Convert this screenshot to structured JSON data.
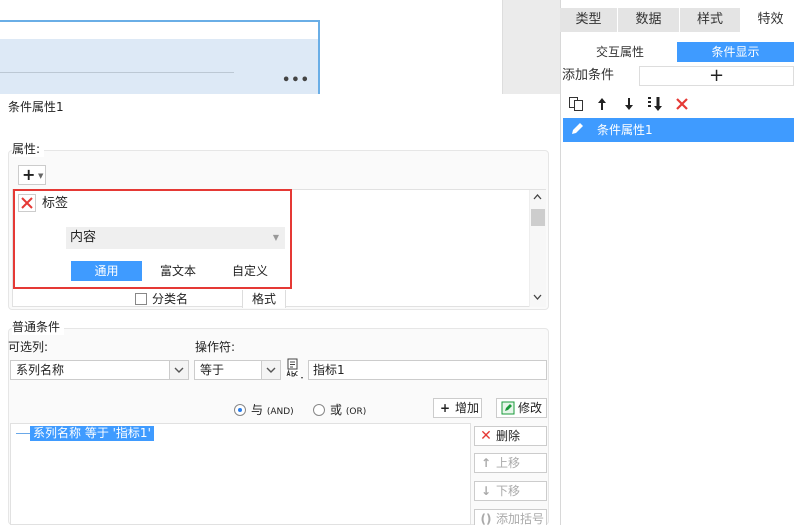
{
  "canvas": {
    "more": "•••"
  },
  "right_panel": {
    "tabs": [
      {
        "label": "类型"
      },
      {
        "label": "数据"
      },
      {
        "label": "样式"
      },
      {
        "label": "特效"
      }
    ],
    "subtabs": [
      {
        "label": "交互属性"
      },
      {
        "label": "条件显示"
      }
    ],
    "add_condition_label": "添加条件",
    "add_icon": "+",
    "toolbar": [
      "copy-icon",
      "arrow-up-icon",
      "arrow-down-icon",
      "move-bottom-icon",
      "delete-icon"
    ],
    "condition_item": "条件属性1"
  },
  "dialog": {
    "title": "条件属性1",
    "attributes": {
      "section_title": "属性:",
      "plus": "+",
      "label_item": "标签",
      "content_select": "内容",
      "mode_tabs": [
        "通用",
        "富文本",
        "自定义"
      ],
      "classify_label": "分类名",
      "format_button": "格式"
    },
    "common": {
      "section_title": "普通条件",
      "column_label": "可选列:",
      "column_value": "系列名称",
      "operator_label": "操作符:",
      "operator_value": "等于",
      "value_input": "指标1",
      "radio_and": "与",
      "radio_and_en": "(AND)",
      "radio_or": "或",
      "radio_or_en": "(OR)",
      "add_button": "增加",
      "modify_button": "修改",
      "condition_expression": "系列名称 等于 '指标1'",
      "delete_button": "删除",
      "up_button": "上移",
      "down_button": "下移",
      "bracket_button": "添加括号"
    }
  }
}
